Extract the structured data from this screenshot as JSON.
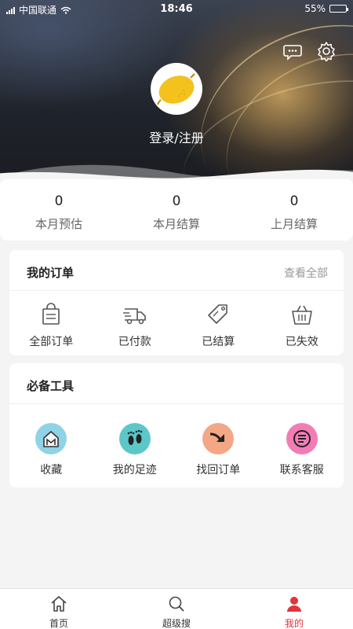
{
  "status_bar": {
    "carrier": "中国联通",
    "time": "18:46",
    "battery": "55%",
    "battery_level": 0.55
  },
  "header": {
    "message_icon": "message-icon",
    "settings_icon": "gear-icon",
    "avatar_icon": "lemon-icon",
    "login_label": "登录/注册"
  },
  "stats": [
    {
      "value": "0",
      "label": "本月预估"
    },
    {
      "value": "0",
      "label": "本月结算"
    },
    {
      "value": "0",
      "label": "上月结算"
    }
  ],
  "orders": {
    "title": "我的订单",
    "view_all": "查看全部",
    "items": [
      {
        "label": "全部订单",
        "icon": "bag-icon"
      },
      {
        "label": "已付款",
        "icon": "truck-icon"
      },
      {
        "label": "已结算",
        "icon": "tag-icon"
      },
      {
        "label": "已失效",
        "icon": "basket-icon"
      }
    ]
  },
  "tools": {
    "title": "必备工具",
    "items": [
      {
        "label": "收藏",
        "icon": "house-icon",
        "color": "#8fd3e8"
      },
      {
        "label": "我的足迹",
        "icon": "footprints-icon",
        "color": "#5cc7c9"
      },
      {
        "label": "找回订单",
        "icon": "arrow-icon",
        "color": "#f3a784"
      },
      {
        "label": "联系客服",
        "icon": "chat-icon",
        "color": "#f27db5"
      }
    ]
  },
  "tabbar": {
    "items": [
      {
        "label": "首页",
        "icon": "home-icon"
      },
      {
        "label": "超级搜",
        "icon": "search-icon"
      },
      {
        "label": "我的",
        "icon": "user-icon"
      }
    ],
    "active_index": 2,
    "active_color": "#e0353a"
  }
}
